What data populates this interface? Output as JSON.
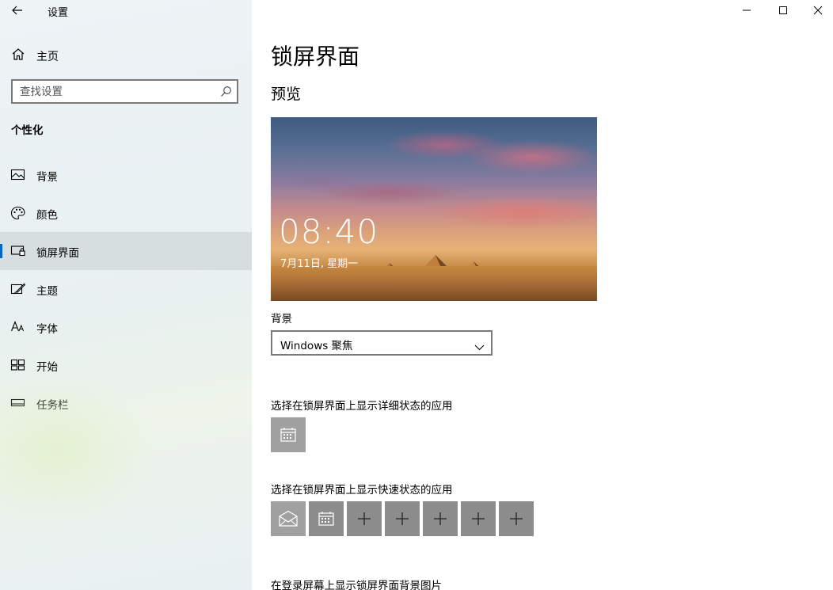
{
  "window": {
    "app_title": "设置",
    "minimize_label": "minimize",
    "maximize_label": "maximize",
    "close_label": "close"
  },
  "sidebar": {
    "home_label": "主页",
    "search_placeholder": "查找设置",
    "section_title": "个性化",
    "items": [
      {
        "label": "背景",
        "icon": "picture-icon",
        "active": false
      },
      {
        "label": "颜色",
        "icon": "palette-icon",
        "active": false
      },
      {
        "label": "锁屏界面",
        "icon": "lock-screen-icon",
        "active": true
      },
      {
        "label": "主题",
        "icon": "theme-brush-icon",
        "active": false
      },
      {
        "label": "字体",
        "icon": "font-icon",
        "active": false
      },
      {
        "label": "开始",
        "icon": "start-tiles-icon",
        "active": false
      },
      {
        "label": "任务栏",
        "icon": "taskbar-icon",
        "active": false
      }
    ]
  },
  "main": {
    "page_title": "锁屏界面",
    "preview_title": "预览",
    "preview": {
      "time": "08:40",
      "date": "7月11日, 星期一"
    },
    "background_label": "背景",
    "background_value": "Windows 聚焦",
    "detail_status_label": "选择在锁屏界面上显示详细状态的应用",
    "quick_status_label": "选择在锁屏界面上显示快速状态的应用",
    "login_bg_label": "在登录屏幕上显示锁屏界面背景图片",
    "detail_apps": [
      {
        "icon": "calendar-icon"
      }
    ],
    "quick_apps": [
      {
        "icon": "mail-icon"
      },
      {
        "icon": "calendar-icon"
      },
      {
        "icon": "add-icon"
      },
      {
        "icon": "add-icon"
      },
      {
        "icon": "add-icon"
      },
      {
        "icon": "add-icon"
      },
      {
        "icon": "add-icon"
      }
    ]
  }
}
